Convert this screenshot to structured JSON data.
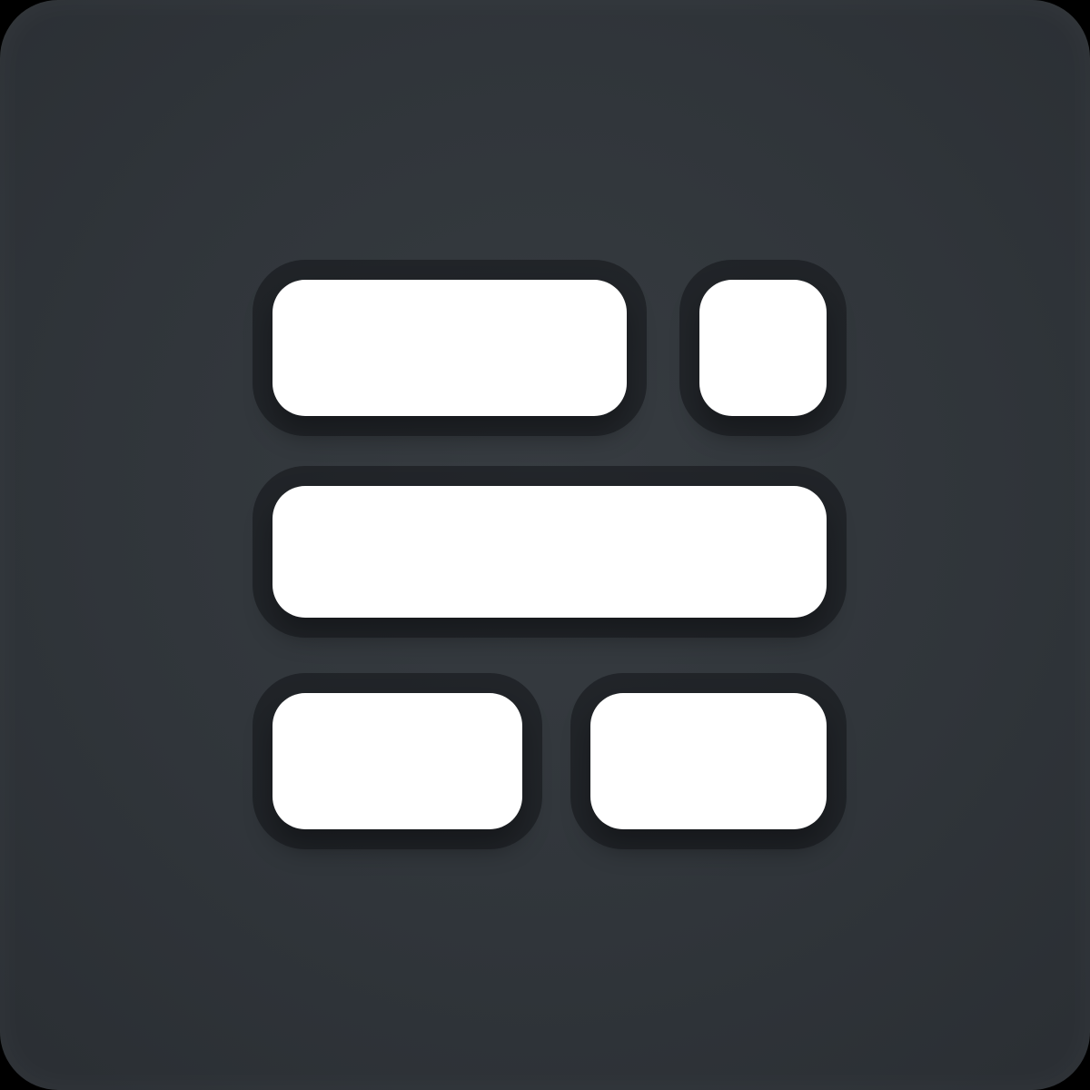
{
  "icon": {
    "name": "layout-grid-icon",
    "tile_color": "#30353a",
    "glyph_color": "#ffffff"
  }
}
